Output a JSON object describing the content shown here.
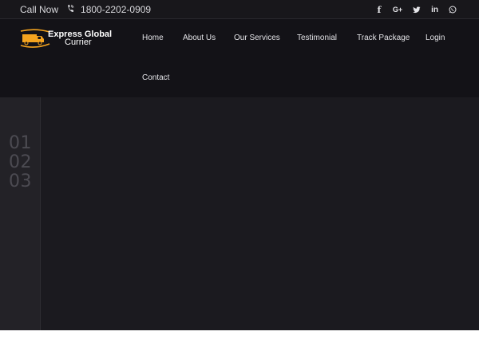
{
  "topbar": {
    "call_label": "Call Now",
    "phone": "1800-2202-0909",
    "social_icons": [
      "facebook-icon",
      "google-plus-icon",
      "twitter-icon",
      "linkedin-icon",
      "whatsapp-icon"
    ]
  },
  "brand": {
    "line1": "Express Global",
    "line2": "Currier",
    "accent": "#f5a41f"
  },
  "nav": {
    "items": [
      "Home",
      "About Us",
      "Our Services",
      "Testimonial",
      "Track Package",
      "Login",
      "Contact"
    ]
  },
  "slider": {
    "numbers": [
      "01",
      "02",
      "03"
    ]
  },
  "colors": {
    "hero_bg": "#1b1a1f",
    "topbar_bg": "#18171b",
    "nav_bg": "#131217",
    "sidebar_bg": "#232227"
  }
}
